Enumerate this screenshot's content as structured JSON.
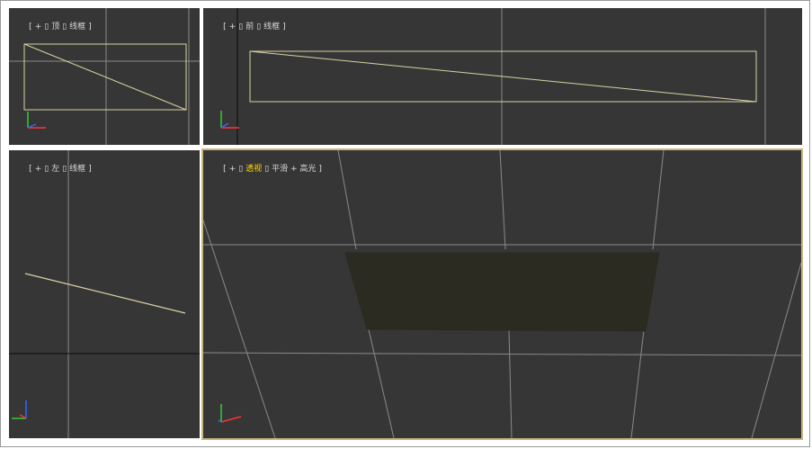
{
  "colors": {
    "viewport_bg": "#363636",
    "grid": "#8a8a8a",
    "world_axis": "#0a0a0a",
    "object_wire": "#d8d3a2",
    "active_border": "#c9b77e",
    "label_accent": "#ffd700",
    "plane_fill": "#2b2b22"
  },
  "viewports": {
    "top": {
      "bracket_open": "[",
      "plus": "+",
      "sep1": "▯",
      "view": "顶",
      "sep2": "▯",
      "shading": "线框",
      "bracket_close": "]"
    },
    "front": {
      "bracket_open": "[",
      "plus": "+",
      "sep1": "▯",
      "view": "前",
      "sep2": "▯",
      "shading": "线框",
      "bracket_close": "]"
    },
    "left": {
      "bracket_open": "[",
      "plus": "+",
      "sep1": "▯",
      "view": "左",
      "sep2": "▯",
      "shading": "线框",
      "bracket_close": "]"
    },
    "perspective": {
      "bracket_open": "[",
      "plus": "+",
      "sep1": "▯",
      "view": "透视",
      "sep2": "▯",
      "shading": "平滑 + 高光",
      "bracket_close": "]"
    }
  }
}
